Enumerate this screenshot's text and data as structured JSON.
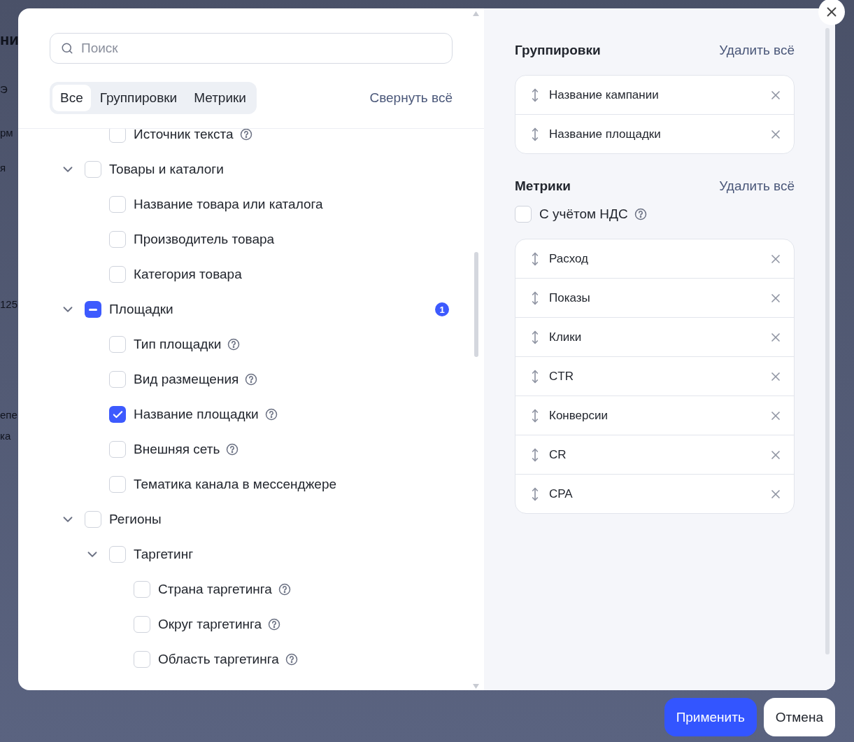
{
  "backdrop": {
    "fragments": [
      "ни",
      "Э",
      "рм",
      "я",
      "125",
      "епе",
      "ка"
    ]
  },
  "search": {
    "placeholder": "Поиск"
  },
  "filter_tabs": [
    {
      "label": "Все",
      "selected": true
    },
    {
      "label": "Группировки",
      "selected": false
    },
    {
      "label": "Метрики",
      "selected": false
    }
  ],
  "collapse_all": "Свернуть всё",
  "tree": [
    {
      "children": [
        {
          "label": "Источник текста",
          "checked": false,
          "indeterminate": false,
          "help": true
        }
      ]
    },
    {
      "label": "Товары и каталоги",
      "checked": false,
      "indeterminate": false,
      "expanded": true,
      "children": [
        {
          "label": "Название товара или каталога",
          "checked": false,
          "indeterminate": false,
          "help": false
        },
        {
          "label": "Производитель товара",
          "checked": false,
          "indeterminate": false,
          "help": false
        },
        {
          "label": "Категория товара",
          "checked": false,
          "indeterminate": false,
          "help": false
        }
      ]
    },
    {
      "label": "Площадки",
      "checked": false,
      "indeterminate": true,
      "expanded": true,
      "badge": "1",
      "children": [
        {
          "label": "Тип площадки",
          "checked": false,
          "indeterminate": false,
          "help": true
        },
        {
          "label": "Вид размещения",
          "checked": false,
          "indeterminate": false,
          "help": true
        },
        {
          "label": "Название площадки",
          "checked": true,
          "indeterminate": false,
          "help": true
        },
        {
          "label": "Внешняя сеть",
          "checked": false,
          "indeterminate": false,
          "help": true
        },
        {
          "label": "Тематика канала в мессенджере",
          "checked": false,
          "indeterminate": false,
          "help": false
        }
      ]
    },
    {
      "label": "Регионы",
      "checked": false,
      "indeterminate": false,
      "expanded": true,
      "children": [
        {
          "label": "Таргетинг",
          "checked": false,
          "indeterminate": false,
          "expanded": true,
          "children": [
            {
              "label": "Страна таргетинга",
              "checked": false,
              "indeterminate": false,
              "help": true
            },
            {
              "label": "Округ таргетинга",
              "checked": false,
              "indeterminate": false,
              "help": true
            },
            {
              "label": "Область таргетинга",
              "checked": false,
              "indeterminate": false,
              "help": true
            }
          ]
        }
      ]
    }
  ],
  "groupings": {
    "title": "Группировки",
    "clear_label": "Удалить всё",
    "items": [
      "Название кампании",
      "Название площадки"
    ]
  },
  "metrics": {
    "title": "Метрики",
    "clear_label": "Удалить всё",
    "vat": {
      "label": "С учётом НДС",
      "checked": false,
      "help": true
    },
    "items": [
      "Расход",
      "Показы",
      "Клики",
      "CTR",
      "Конверсии",
      "CR",
      "CPA"
    ]
  },
  "footer": {
    "apply": "Применить",
    "cancel": "Отмена"
  }
}
